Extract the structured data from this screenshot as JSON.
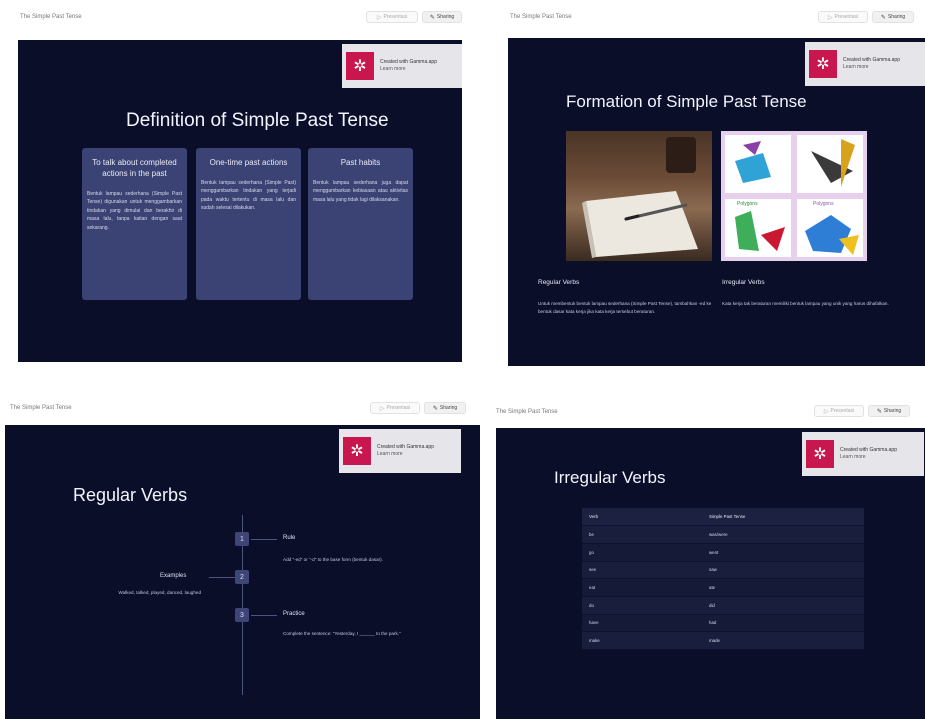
{
  "common": {
    "doc_title": "The Simple Past Tense",
    "toolbar": {
      "present_label": "Presentasi",
      "share_label": "Sharing",
      "present_icon": "play-icon",
      "share_icon": "pen-icon"
    },
    "badge": {
      "line1": "Created with Gamma.app",
      "line2": "Learn more",
      "logo_icon": "gamma-logo-icon",
      "logo_color": "#c8174e"
    },
    "slide_bg": "#0a0e28",
    "card_bg": "#3a4373"
  },
  "slides": {
    "definition": {
      "title": "Definition of Simple Past Tense",
      "cards": [
        {
          "heading": "To talk about completed actions in the past",
          "body": "Bentuk lampau sederhana (Simple Past Tense) digunakan untuk menggambarkan tindakan yang dimulai dan berakhir di masa lalu, tanpa kaitan dengan saat sekarang."
        },
        {
          "heading": "One-time past actions",
          "body": "Bentuk lampau sederhana (Simple Past) menggambarkan tindakan yang terjadi pada waktu tertentu di masa lalu dan sudah selesai dilakukan."
        },
        {
          "heading": "Past habits",
          "body": "Bentuk lampau sederhana juga dapat menggambarkan kebiasaan atau aktivitas masa lalu yang tidak lagi dilaksanakan."
        }
      ]
    },
    "formation": {
      "title": "Formation of Simple Past Tense",
      "columns": [
        {
          "heading": "Regular Verbs",
          "body": "Untuk membentuk bentuk lampau sederhana (Simple Past Tense), tambahkan -ed ke bentuk dasar kata kerja jika kata kerja tersebut beraturan.",
          "image_icon": "notebook-pen-image"
        },
        {
          "heading": "Irregular Verbs",
          "body": "Kata kerja tak beraturan memiliki bentuk lampau yang unik yang harus dihafalkan.",
          "image_icon": "polygon-shapes-image",
          "image_labels": [
            "Polygons",
            "Polygons"
          ]
        }
      ]
    },
    "regular": {
      "title": "Regular Verbs",
      "steps": [
        {
          "num": "1",
          "heading": "Rule",
          "text": "Add \"-ed\" or \"-d\" to the base form (bentuk dasar)."
        },
        {
          "num": "2",
          "heading": "Examples",
          "text": "Walked, talked, played, danced, laughed"
        },
        {
          "num": "3",
          "heading": "Practice",
          "text": "Complete the sentence: \"Yesterday, I ______ to the park.\""
        }
      ]
    },
    "irregular": {
      "title": "Irregular Verbs",
      "table": {
        "headers": [
          "Verb",
          "Simple Past Tense"
        ],
        "rows": [
          [
            "be",
            "was/were"
          ],
          [
            "go",
            "went"
          ],
          [
            "see",
            "saw"
          ],
          [
            "eat",
            "ate"
          ],
          [
            "do",
            "did"
          ],
          [
            "have",
            "had"
          ],
          [
            "make",
            "made"
          ]
        ]
      }
    }
  }
}
